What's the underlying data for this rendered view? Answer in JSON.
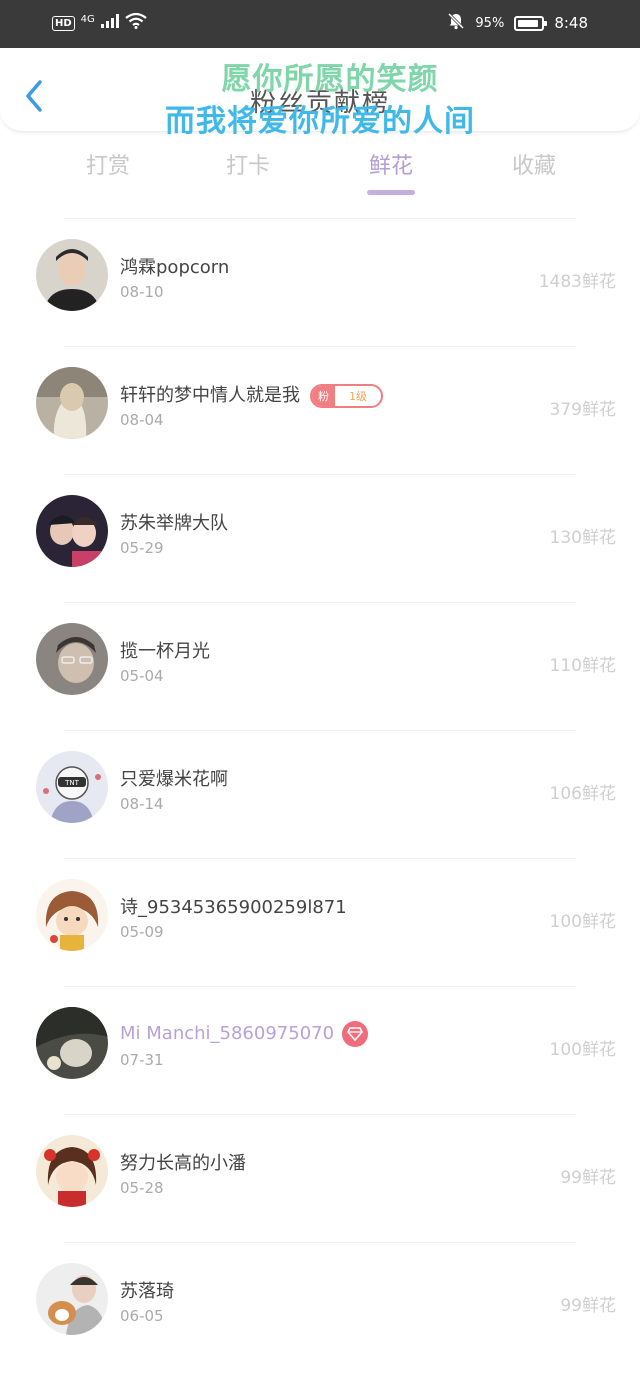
{
  "status_bar": {
    "hd": "HD",
    "network": "4G",
    "battery_text": "95%",
    "time": "8:48",
    "icons": [
      "signal-icon",
      "wifi-icon",
      "bell-off-icon",
      "battery-icon"
    ]
  },
  "header": {
    "title": "粉丝贡献榜",
    "overlay_line1": "愿你所愿的笑颜",
    "overlay_line2": "而我将爱你所爱的人间"
  },
  "tabs": [
    {
      "label": "打赏"
    },
    {
      "label": "打卡"
    },
    {
      "label": "鲜花"
    },
    {
      "label": "收藏"
    }
  ],
  "active_tab": "鲜花",
  "list": [
    {
      "name": "鸿霖popcorn",
      "date": "08-10",
      "amount": "1483鲜花"
    },
    {
      "name": "轩轩的梦中情人就是我",
      "date": "08-04",
      "amount": "379鲜花",
      "badge": {
        "label": "粉",
        "level": "1级"
      }
    },
    {
      "name": "苏朱举牌大队",
      "date": "05-29",
      "amount": "130鲜花"
    },
    {
      "name": "揽一杯月光",
      "date": "05-04",
      "amount": "110鲜花"
    },
    {
      "name": "只爱爆米花啊",
      "date": "08-14",
      "amount": "106鲜花"
    },
    {
      "name": "诗_95345365900259l871",
      "date": "05-09",
      "amount": "100鲜花"
    },
    {
      "name": "Mi Manchi_5860975070",
      "date": "07-31",
      "amount": "100鲜花"
    },
    {
      "name": "努力长高的小潘",
      "date": "05-28",
      "amount": "99鲜花"
    },
    {
      "name": "苏落琦",
      "date": "06-05",
      "amount": "99鲜花"
    }
  ],
  "colors": {
    "accent": "#b49fd4",
    "overlay_green": "#7fd6a8",
    "overlay_blue": "#3fb8ea",
    "badge_pink": "#f07e83",
    "back_blue": "#3b9be0"
  }
}
